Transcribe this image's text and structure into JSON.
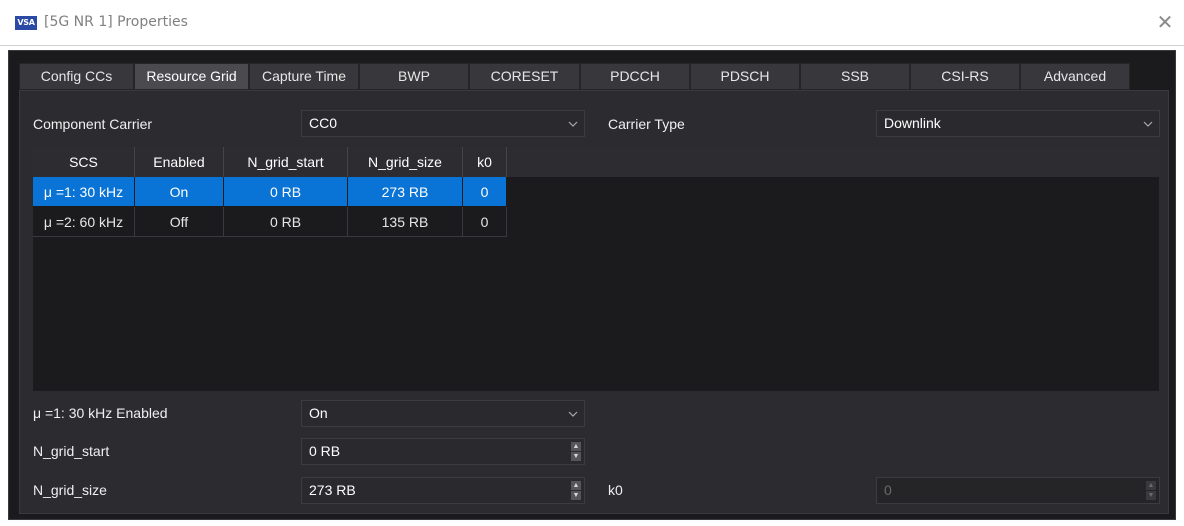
{
  "titlebar": {
    "app_icon_text": "VSA",
    "title": "[5G NR 1] Properties",
    "close_glyph": "✕"
  },
  "tabs": [
    {
      "label": "Config CCs",
      "active": false
    },
    {
      "label": "Resource Grid",
      "active": true
    },
    {
      "label": "Capture Time",
      "active": false
    },
    {
      "label": "BWP",
      "active": false
    },
    {
      "label": "CORESET",
      "active": false
    },
    {
      "label": "PDCCH",
      "active": false
    },
    {
      "label": "PDSCH",
      "active": false
    },
    {
      "label": "SSB",
      "active": false
    },
    {
      "label": "CSI-RS",
      "active": false
    },
    {
      "label": "Advanced",
      "active": false
    }
  ],
  "component_carrier": {
    "label": "Component Carrier",
    "value": "CC0"
  },
  "carrier_type": {
    "label": "Carrier Type",
    "value": "Downlink"
  },
  "grid": {
    "columns": [
      "SCS",
      "Enabled",
      "N_grid_start",
      "N_grid_size",
      "k0"
    ],
    "rows": [
      {
        "scs": "μ =1: 30 kHz",
        "enabled": "On",
        "start": "0 RB",
        "size": "273 RB",
        "k0": "0",
        "selected": true
      },
      {
        "scs": "μ =2: 60 kHz",
        "enabled": "Off",
        "start": "0 RB",
        "size": "135 RB",
        "k0": "0",
        "selected": false
      }
    ]
  },
  "settings": {
    "enabled": {
      "label": "μ =1: 30 kHz Enabled",
      "value": "On"
    },
    "n_grid_start": {
      "label": "N_grid_start",
      "value": "0 RB"
    },
    "n_grid_size": {
      "label": "N_grid_size",
      "value": "273 RB"
    },
    "k0": {
      "label": "k0",
      "value": "0"
    }
  },
  "colors": {
    "selection": "#0a74d6",
    "background": "#1b1b1e",
    "panel": "#2c2c30"
  }
}
